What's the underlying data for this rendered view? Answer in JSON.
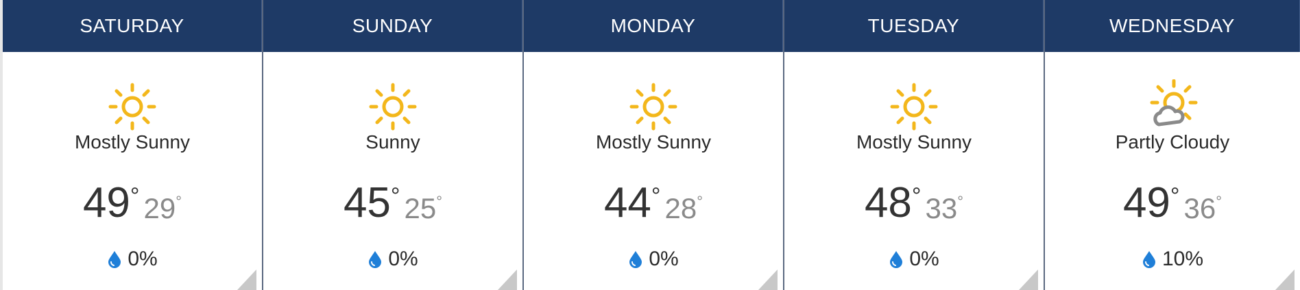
{
  "days": [
    {
      "name": "SATURDAY",
      "condition": "Mostly Sunny",
      "icon": "sun-icon",
      "high": "49",
      "low": "29",
      "precip": "0%"
    },
    {
      "name": "SUNDAY",
      "condition": "Sunny",
      "icon": "sun-icon",
      "high": "45",
      "low": "25",
      "precip": "0%"
    },
    {
      "name": "MONDAY",
      "condition": "Mostly Sunny",
      "icon": "sun-icon",
      "high": "44",
      "low": "28",
      "precip": "0%"
    },
    {
      "name": "TUESDAY",
      "condition": "Mostly Sunny",
      "icon": "sun-icon",
      "high": "48",
      "low": "33",
      "precip": "0%"
    },
    {
      "name": "WEDNESDAY",
      "condition": "Partly Cloudy",
      "icon": "partly-cloudy-icon",
      "high": "49",
      "low": "36",
      "precip": "10%"
    }
  ],
  "degree_symbol": "°",
  "colors": {
    "header_bg": "#1e3a66",
    "header_text": "#ffffff",
    "sun": "#f3b71b",
    "cloud": "#8a8a8a",
    "drop": "#1f7fd8",
    "corner": "#c8c8c8"
  }
}
